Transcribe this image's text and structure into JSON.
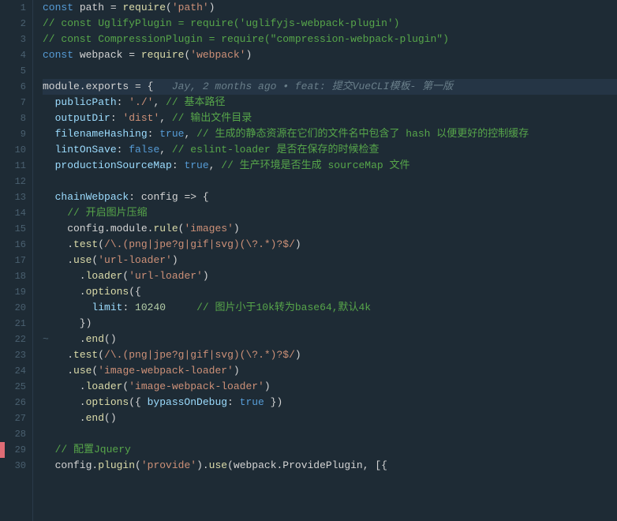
{
  "editor": {
    "background": "#1e2b35",
    "line_height": 20
  },
  "lines": [
    {
      "num": 1,
      "content": "const path = require('path')",
      "tokens": [
        {
          "t": "kw",
          "v": "const"
        },
        {
          "t": "plain",
          "v": " path = "
        },
        {
          "t": "fn",
          "v": "require"
        },
        {
          "t": "punct",
          "v": "("
        },
        {
          "t": "str",
          "v": "'path'"
        },
        {
          "t": "punct",
          "v": ")"
        }
      ]
    },
    {
      "num": 2,
      "content": "// const UglifyPlugin = require('uglifyjs-webpack-plugin')",
      "tokens": [
        {
          "t": "comment",
          "v": "// const UglifyPlugin = require('uglifyjs-webpack-plugin')"
        }
      ]
    },
    {
      "num": 3,
      "content": "// const CompressionPlugin = require(\"compression-webpack-plugin\")",
      "tokens": [
        {
          "t": "comment",
          "v": "// const CompressionPlugin = require(\"compression-webpack-plugin\")"
        }
      ]
    },
    {
      "num": 4,
      "content": "const webpack = require('webpack')",
      "tokens": [
        {
          "t": "kw",
          "v": "const"
        },
        {
          "t": "plain",
          "v": " webpack = "
        },
        {
          "t": "fn",
          "v": "require"
        },
        {
          "t": "punct",
          "v": "("
        },
        {
          "t": "str",
          "v": "'webpack'"
        },
        {
          "t": "punct",
          "v": ")"
        }
      ]
    },
    {
      "num": 5,
      "content": "",
      "tokens": []
    },
    {
      "num": 6,
      "content": "module.exports = {   Jay, 2 months ago • feat: 提交VueCLI模板- 第一版",
      "highlighted": true,
      "tokens": [
        {
          "t": "plain",
          "v": "module.exports = {   "
        },
        {
          "t": "git-blame",
          "v": "Jay, 2 months ago • feat: 提交VueCLI模板- 第一版"
        }
      ]
    },
    {
      "num": 7,
      "content": "  publicPath: './', // 基本路径",
      "tokens": [
        {
          "t": "plain",
          "v": "  "
        },
        {
          "t": "prop",
          "v": "publicPath"
        },
        {
          "t": "plain",
          "v": ": "
        },
        {
          "t": "str",
          "v": "'./'"
        },
        {
          "t": "plain",
          "v": ", "
        },
        {
          "t": "comment-cn",
          "v": "// 基本路径"
        }
      ]
    },
    {
      "num": 8,
      "content": "  outputDir: 'dist', // 输出文件目录",
      "tokens": [
        {
          "t": "plain",
          "v": "  "
        },
        {
          "t": "prop",
          "v": "outputDir"
        },
        {
          "t": "plain",
          "v": ": "
        },
        {
          "t": "str",
          "v": "'dist'"
        },
        {
          "t": "plain",
          "v": ", "
        },
        {
          "t": "comment-cn",
          "v": "// 输出文件目录"
        }
      ]
    },
    {
      "num": 9,
      "content": "  filenameHashing: true, // 生成的静态资源在它们的文件名中包含了 hash 以便更好的控制缓存",
      "tokens": [
        {
          "t": "plain",
          "v": "  "
        },
        {
          "t": "prop",
          "v": "filenameHashing"
        },
        {
          "t": "plain",
          "v": ": "
        },
        {
          "t": "kw",
          "v": "true"
        },
        {
          "t": "plain",
          "v": ", "
        },
        {
          "t": "comment-cn",
          "v": "// 生成的静态资源在它们的文件名中包含了 hash 以便更好的控制缓存"
        }
      ]
    },
    {
      "num": 10,
      "content": "  lintOnSave: false, // eslint-loader 是否在保存的时候检查",
      "tokens": [
        {
          "t": "plain",
          "v": "  "
        },
        {
          "t": "prop",
          "v": "lintOnSave"
        },
        {
          "t": "plain",
          "v": ": "
        },
        {
          "t": "kw",
          "v": "false"
        },
        {
          "t": "plain",
          "v": ", "
        },
        {
          "t": "comment-cn",
          "v": "// eslint-loader 是否在保存的时候检查"
        }
      ]
    },
    {
      "num": 11,
      "content": "  productionSourceMap: true, // 生产环境是否生成 sourceMap 文件",
      "tokens": [
        {
          "t": "plain",
          "v": "  "
        },
        {
          "t": "prop",
          "v": "productionSourceMap"
        },
        {
          "t": "plain",
          "v": ": "
        },
        {
          "t": "kw",
          "v": "true"
        },
        {
          "t": "plain",
          "v": ", "
        },
        {
          "t": "comment-cn",
          "v": "// 生产环境是否生成 sourceMap 文件"
        }
      ]
    },
    {
      "num": 12,
      "content": "",
      "tokens": []
    },
    {
      "num": 13,
      "content": "  chainWebpack: config => {",
      "tokens": [
        {
          "t": "plain",
          "v": "  "
        },
        {
          "t": "prop",
          "v": "chainWebpack"
        },
        {
          "t": "plain",
          "v": ": config => {"
        }
      ]
    },
    {
      "num": 14,
      "content": "    // 开启图片压缩",
      "tokens": [
        {
          "t": "comment-cn",
          "v": "    // 开启图片压缩"
        }
      ]
    },
    {
      "num": 15,
      "content": "    config.module.rule('images')",
      "tokens": [
        {
          "t": "plain",
          "v": "    config.module."
        },
        {
          "t": "fn",
          "v": "rule"
        },
        {
          "t": "punct",
          "v": "("
        },
        {
          "t": "str",
          "v": "'images'"
        },
        {
          "t": "punct",
          "v": ")"
        }
      ]
    },
    {
      "num": 16,
      "content": "    .test(/\\.(png|jpe?g|gif|svg)(\\?.*)?$/)",
      "tokens": [
        {
          "t": "plain",
          "v": "    ."
        },
        {
          "t": "fn",
          "v": "test"
        },
        {
          "t": "punct",
          "v": "("
        },
        {
          "t": "str",
          "v": "/\\.(png|jpe?g|gif|svg)(\\?.*)?$/"
        },
        {
          "t": "punct",
          "v": ")"
        }
      ]
    },
    {
      "num": 17,
      "content": "    .use('url-loader')",
      "tokens": [
        {
          "t": "plain",
          "v": "    ."
        },
        {
          "t": "fn",
          "v": "use"
        },
        {
          "t": "punct",
          "v": "("
        },
        {
          "t": "str",
          "v": "'url-loader'"
        },
        {
          "t": "punct",
          "v": ")"
        }
      ]
    },
    {
      "num": 18,
      "content": "      .loader('url-loader')",
      "tokens": [
        {
          "t": "plain",
          "v": "      ."
        },
        {
          "t": "fn",
          "v": "loader"
        },
        {
          "t": "punct",
          "v": "("
        },
        {
          "t": "str",
          "v": "'url-loader'"
        },
        {
          "t": "punct",
          "v": ")"
        }
      ]
    },
    {
      "num": 19,
      "content": "      .options({",
      "tokens": [
        {
          "t": "plain",
          "v": "      ."
        },
        {
          "t": "fn",
          "v": "options"
        },
        {
          "t": "punct",
          "v": "({"
        }
      ]
    },
    {
      "num": 20,
      "content": "        limit: 10240     // 图片小于10k转为base64,默认4k",
      "tokens": [
        {
          "t": "plain",
          "v": "        "
        },
        {
          "t": "prop",
          "v": "limit"
        },
        {
          "t": "plain",
          "v": ": "
        },
        {
          "t": "num",
          "v": "10240"
        },
        {
          "t": "plain",
          "v": "     "
        },
        {
          "t": "comment-cn",
          "v": "// 图片小于10k转为base64,默认4k"
        }
      ]
    },
    {
      "num": 21,
      "content": "      })",
      "tokens": [
        {
          "t": "plain",
          "v": "      })"
        }
      ]
    },
    {
      "num": 22,
      "content": "~     .end()",
      "tilde": true,
      "tokens": [
        {
          "t": "tilde",
          "v": "~"
        },
        {
          "t": "plain",
          "v": "     ."
        },
        {
          "t": "fn",
          "v": "end"
        },
        {
          "t": "punct",
          "v": "()"
        }
      ]
    },
    {
      "num": 23,
      "content": "    .test(/\\.(png|jpe?g|gif|svg)(\\?.*)?$/)",
      "tokens": [
        {
          "t": "plain",
          "v": "    ."
        },
        {
          "t": "fn",
          "v": "test"
        },
        {
          "t": "punct",
          "v": "("
        },
        {
          "t": "str",
          "v": "/\\.(png|jpe?g|gif|svg)(\\?.*)?$/"
        },
        {
          "t": "punct",
          "v": ")"
        }
      ]
    },
    {
      "num": 24,
      "content": "    .use('image-webpack-loader')",
      "tokens": [
        {
          "t": "plain",
          "v": "    ."
        },
        {
          "t": "fn",
          "v": "use"
        },
        {
          "t": "punct",
          "v": "("
        },
        {
          "t": "str",
          "v": "'image-webpack-loader'"
        },
        {
          "t": "punct",
          "v": ")"
        }
      ]
    },
    {
      "num": 25,
      "content": "      .loader('image-webpack-loader')",
      "tokens": [
        {
          "t": "plain",
          "v": "      ."
        },
        {
          "t": "fn",
          "v": "loader"
        },
        {
          "t": "punct",
          "v": "("
        },
        {
          "t": "str",
          "v": "'image-webpack-loader'"
        },
        {
          "t": "punct",
          "v": ")"
        }
      ]
    },
    {
      "num": 26,
      "content": "      .options({ bypassOnDebug: true })",
      "tokens": [
        {
          "t": "plain",
          "v": "      ."
        },
        {
          "t": "fn",
          "v": "options"
        },
        {
          "t": "punct",
          "v": "({ "
        },
        {
          "t": "prop",
          "v": "bypassOnDebug"
        },
        {
          "t": "plain",
          "v": ": "
        },
        {
          "t": "kw",
          "v": "true"
        },
        {
          "t": "plain",
          "v": " })"
        }
      ]
    },
    {
      "num": 27,
      "content": "      .end()",
      "tokens": [
        {
          "t": "plain",
          "v": "      ."
        },
        {
          "t": "fn",
          "v": "end"
        },
        {
          "t": "punct",
          "v": "()"
        }
      ]
    },
    {
      "num": 28,
      "content": "",
      "tokens": []
    },
    {
      "num": 29,
      "content": "  // 配置Jquery",
      "tokens": [
        {
          "t": "comment-cn",
          "v": "  // 配置Jquery"
        }
      ]
    },
    {
      "num": 30,
      "content": "  config.plugin('provide').use(webpack.ProvidePlugin, [{",
      "tokens": [
        {
          "t": "plain",
          "v": "  config."
        },
        {
          "t": "fn",
          "v": "plugin"
        },
        {
          "t": "punct",
          "v": "("
        },
        {
          "t": "str",
          "v": "'provide'"
        },
        {
          "t": "punct",
          "v": ")."
        },
        {
          "t": "fn",
          "v": "use"
        },
        {
          "t": "punct",
          "v": "("
        },
        {
          "t": "plain",
          "v": "webpack.ProvidePlugin, [{"
        }
      ]
    }
  ]
}
